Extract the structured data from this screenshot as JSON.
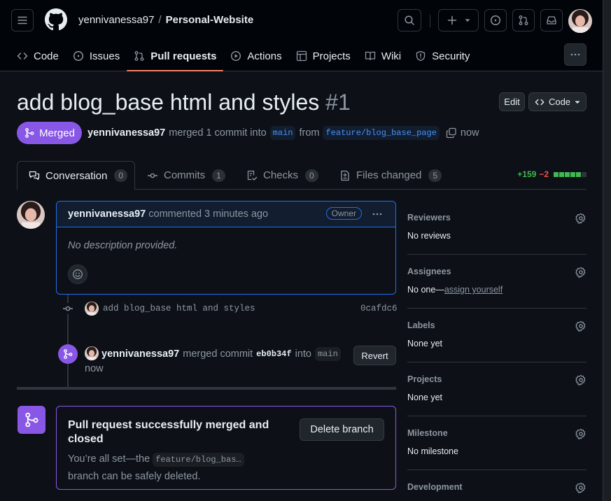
{
  "header": {
    "owner": "yennivanessa97",
    "separator": "/",
    "repo": "Personal-Website"
  },
  "nav": [
    {
      "label": "Code",
      "icon": "code-icon"
    },
    {
      "label": "Issues",
      "icon": "issue-opened-icon"
    },
    {
      "label": "Pull requests",
      "icon": "git-pull-request-icon",
      "active": true
    },
    {
      "label": "Actions",
      "icon": "play-icon"
    },
    {
      "label": "Projects",
      "icon": "table-icon"
    },
    {
      "label": "Wiki",
      "icon": "book-icon"
    },
    {
      "label": "Security",
      "icon": "shield-icon"
    }
  ],
  "pr": {
    "title": "add blog_base html and styles",
    "number": "#1",
    "edit_label": "Edit",
    "code_label": "Code",
    "state": "Merged",
    "author": "yennivanessa97",
    "merged_text": "merged 1 commit into",
    "base_branch": "main",
    "from_text": "from",
    "head_branch": "feature/blog_base_page",
    "time": "now"
  },
  "tabs": [
    {
      "label": "Conversation",
      "count": "0"
    },
    {
      "label": "Commits",
      "count": "1"
    },
    {
      "label": "Checks",
      "count": "0"
    },
    {
      "label": "Files changed",
      "count": "5"
    }
  ],
  "diffstat": {
    "additions": "+159",
    "deletions": "−2"
  },
  "comment": {
    "author": "yennivanessa97",
    "action": "commented 3 minutes ago",
    "badge": "Owner",
    "body": "No description provided."
  },
  "commit": {
    "message": "add blog_base html and styles",
    "sha": "0cafdc6"
  },
  "merge_event": {
    "author": "yennivanessa97",
    "action": "merged commit",
    "sha": "eb0b34f",
    "into": "into",
    "branch": "main",
    "time": "now",
    "revert_label": "Revert"
  },
  "merge_box": {
    "title": "Pull request successfully merged and closed",
    "text_before": "You’re all set—the",
    "branch": "feature/blog_bas…",
    "text_after": "branch can be safely deleted.",
    "delete_label": "Delete branch"
  },
  "sidebar": [
    {
      "title": "Reviewers",
      "value": "No reviews"
    },
    {
      "title": "Assignees",
      "value": "No one—",
      "link": "assign yourself"
    },
    {
      "title": "Labels",
      "value": "None yet"
    },
    {
      "title": "Projects",
      "value": "None yet"
    },
    {
      "title": "Milestone",
      "value": "No milestone"
    },
    {
      "title": "Development",
      "value": ""
    }
  ],
  "colors": {
    "merged": "#8957e5",
    "accent": "#f78166",
    "link": "#4493f8",
    "additions": "#3fb950",
    "deletions": "#f85149"
  }
}
